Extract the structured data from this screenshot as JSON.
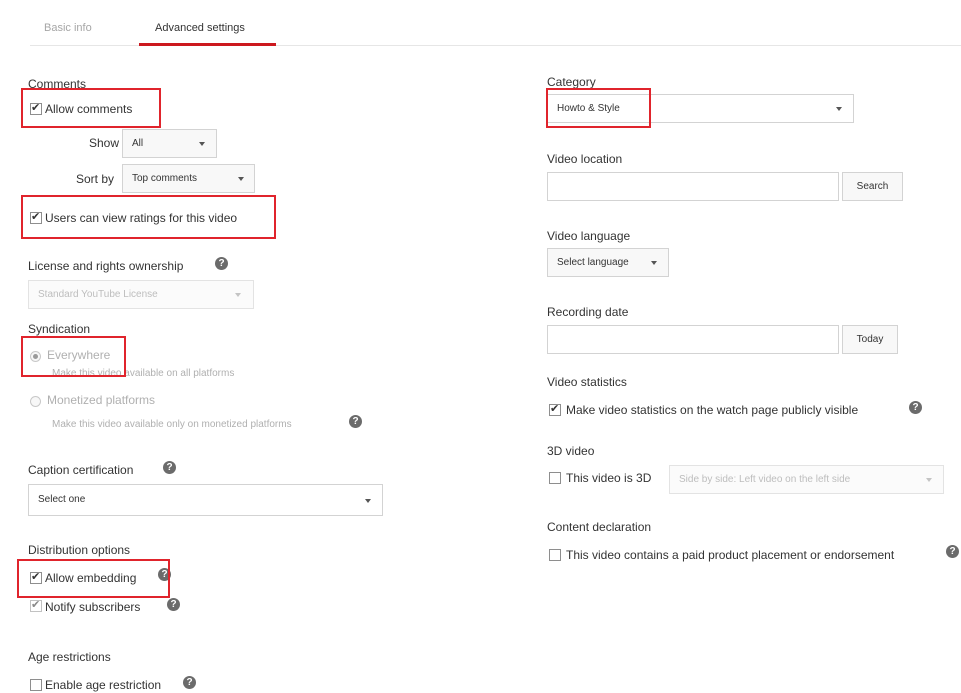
{
  "tabs": {
    "basic": "Basic info",
    "advanced": "Advanced settings"
  },
  "comments": {
    "heading": "Comments",
    "allow_label": "Allow comments",
    "allow_checked": true,
    "show_label": "Show",
    "show_value": "All",
    "sort_label": "Sort by",
    "sort_value": "Top comments",
    "ratings_label": "Users can view ratings for this video",
    "ratings_checked": true
  },
  "license": {
    "heading": "License and rights ownership",
    "value": "Standard YouTube License"
  },
  "syndication": {
    "heading": "Syndication",
    "everywhere_label": "Everywhere",
    "everywhere_desc": "Make this video available on all platforms",
    "monetized_label": "Monetized platforms",
    "monetized_desc": "Make this video available only on monetized platforms",
    "selected": "Everywhere"
  },
  "caption": {
    "heading": "Caption certification",
    "value": "Select one"
  },
  "distribution": {
    "heading": "Distribution options",
    "embedding_label": "Allow embedding",
    "embedding_checked": true,
    "notify_label": "Notify subscribers",
    "notify_checked": true
  },
  "age": {
    "heading": "Age restrictions",
    "label": "Enable age restriction",
    "checked": false
  },
  "category": {
    "heading": "Category",
    "value": "Howto & Style"
  },
  "location": {
    "heading": "Video location",
    "search_button": "Search",
    "value": ""
  },
  "language": {
    "heading": "Video language",
    "value": "Select language"
  },
  "recording": {
    "heading": "Recording date",
    "today_button": "Today",
    "value": ""
  },
  "statistics": {
    "heading": "Video statistics",
    "label": "Make video statistics on the watch page publicly visible",
    "checked": true
  },
  "video3d": {
    "heading": "3D video",
    "label": "This video is 3D",
    "checked": false,
    "mode_value": "Side by side: Left video on the left side"
  },
  "content": {
    "heading": "Content declaration",
    "label": "This video contains a paid product placement or endorsement",
    "checked": false
  },
  "icons": {
    "help": "help-icon",
    "caret": "caret-down-icon",
    "check": "checkmark-icon"
  },
  "colors": {
    "highlight": "#e0242c",
    "tab_accent": "#cc181e"
  }
}
